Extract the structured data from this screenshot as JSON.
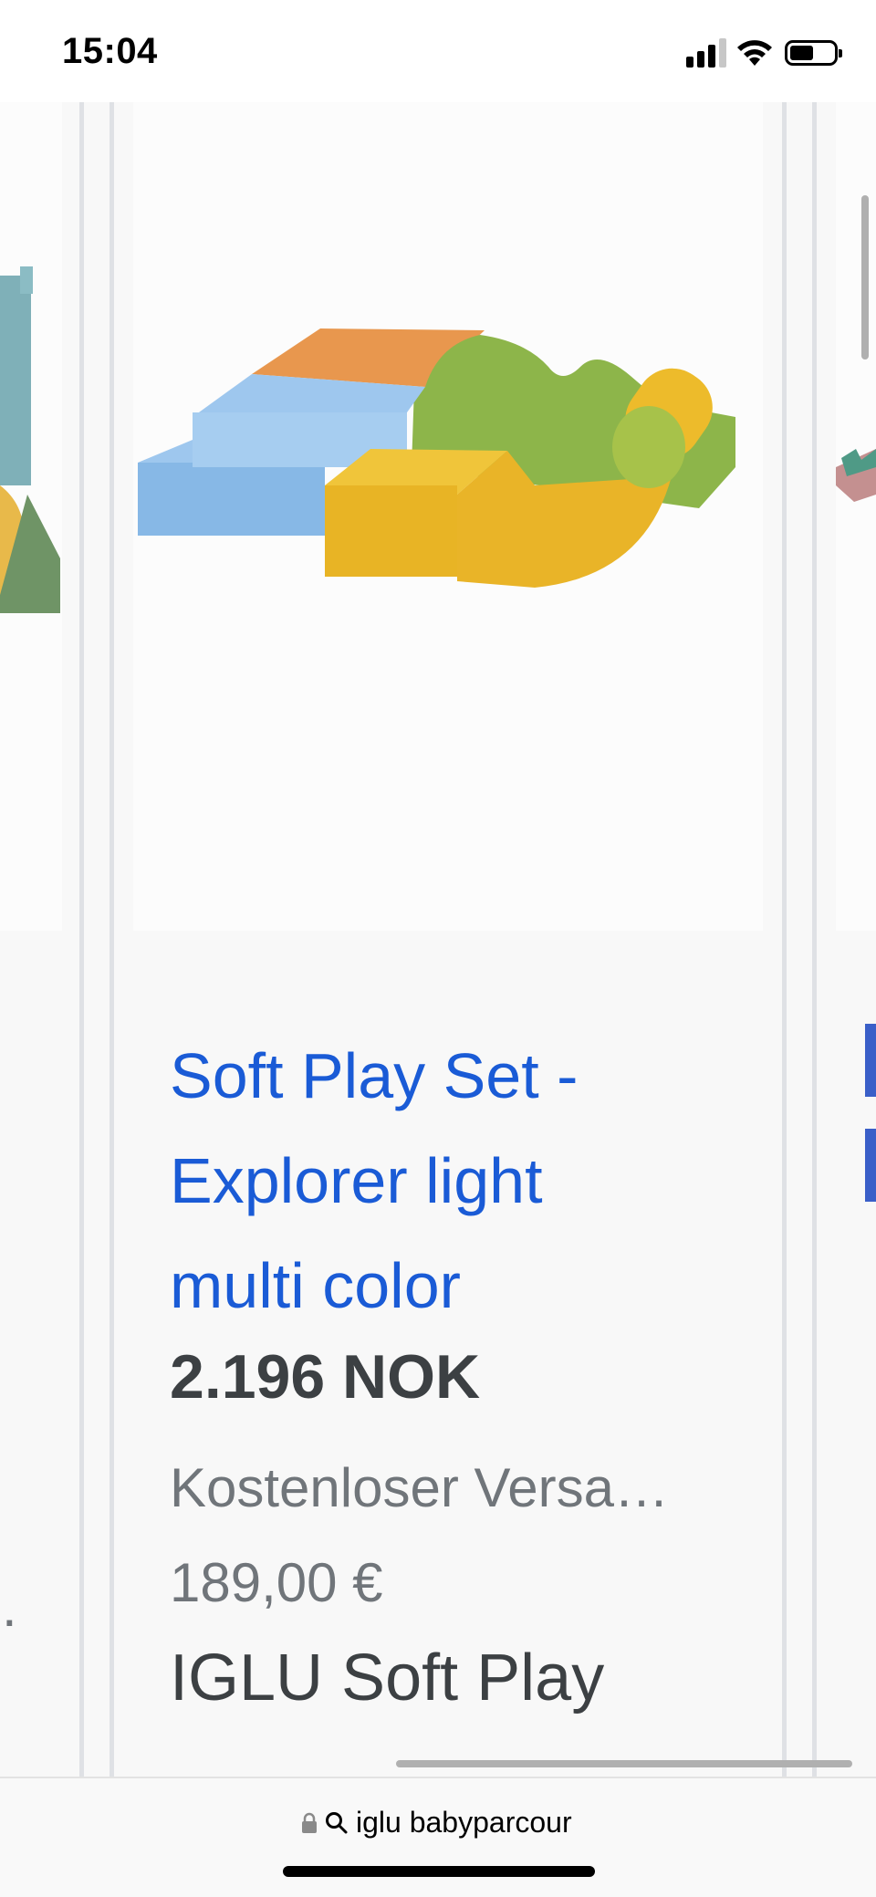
{
  "status_bar": {
    "time": "15:04",
    "icons": [
      "signal-icon",
      "wifi-icon",
      "battery-icon"
    ]
  },
  "product": {
    "title": "Soft Play Set - Explorer light multi color",
    "price": "2.196 NOK",
    "shipping": "Kostenloser Versa…",
    "original_price": "189,00 €",
    "merchant": "IGLU Soft Play",
    "image_icon": "soft-play-set-image"
  },
  "left_card": {
    "ellipsis": "."
  },
  "address_bar": {
    "query": "iglu babyparcour",
    "icons": [
      "lock-icon",
      "search-icon"
    ]
  },
  "colors": {
    "link": "#1a5bd6",
    "price": "#3c4043",
    "secondary": "#70757a",
    "background": "#f8f8f8"
  }
}
